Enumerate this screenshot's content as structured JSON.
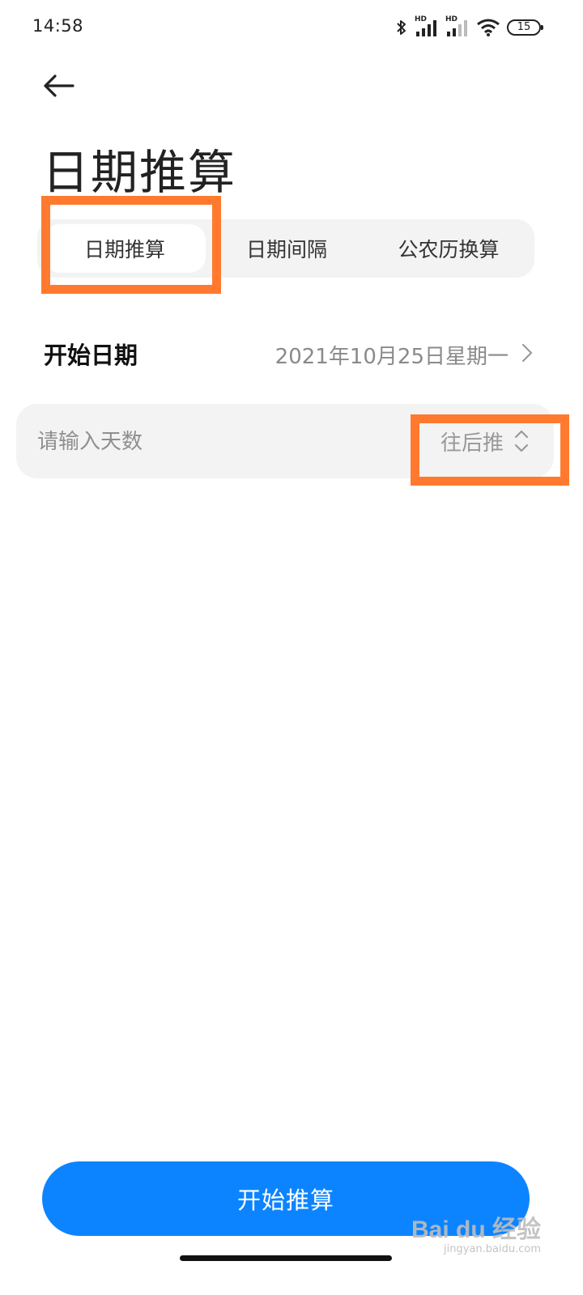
{
  "status_bar": {
    "time": "14:58",
    "signal_1_label": "HD",
    "signal_2_label": "HD",
    "battery": "15"
  },
  "header": {
    "back_icon": "arrow-left-icon",
    "title": "日期推算"
  },
  "tabs": [
    {
      "label": "日期推算",
      "active": true
    },
    {
      "label": "日期间隔",
      "active": false
    },
    {
      "label": "公农历换算",
      "active": false
    }
  ],
  "start_date": {
    "label": "开始日期",
    "value": "2021年10月25日星期一",
    "icon": "chevron-right-icon"
  },
  "days_input": {
    "placeholder": "请输入天数",
    "value": "",
    "direction": "往后推",
    "direction_icon": "chevron-up-down-icon"
  },
  "primary_action": {
    "label": "开始推算"
  },
  "watermark": {
    "main": "Bai du 经验",
    "sub": "jingyan.baidu.com"
  },
  "colors": {
    "accent": "#0d84ff",
    "highlight": "#ff7a2e",
    "panel_bg": "#f3f3f3"
  }
}
